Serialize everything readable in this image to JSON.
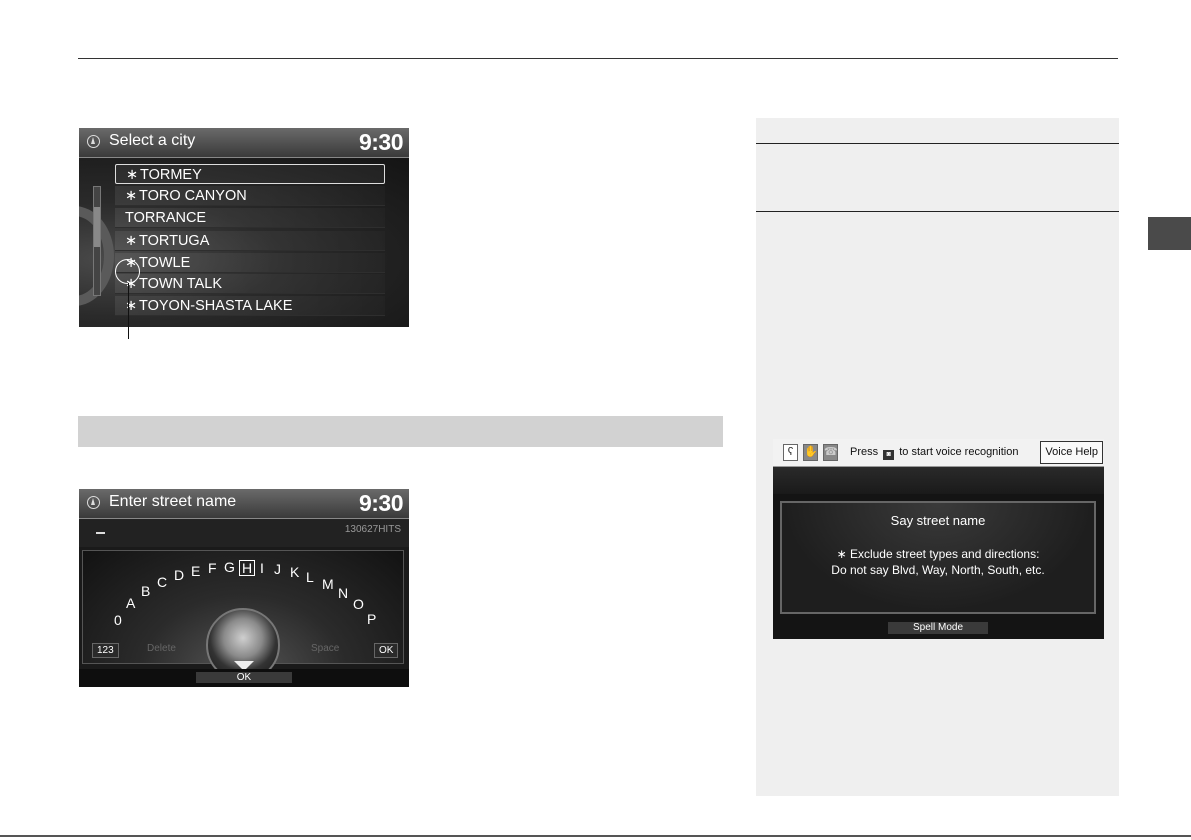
{
  "city_screen": {
    "title": "Select a city",
    "clock": "9:30",
    "cities": [
      {
        "star": "∗",
        "name": "TORMEY"
      },
      {
        "star": "∗",
        "name": "TORO CANYON"
      },
      {
        "star": "",
        "name": "TORRANCE"
      },
      {
        "star": "∗",
        "name": "TORTUGA"
      },
      {
        "star": "∗",
        "name": "TOWLE"
      },
      {
        "star": "∗",
        "name": "TOWN TALK"
      },
      {
        "star": "∗",
        "name": "TOYON-SHASTA LAKE"
      }
    ]
  },
  "street_screen": {
    "title": "Enter street name",
    "clock": "9:30",
    "hits": "130627HITS",
    "letters": [
      "0",
      "A",
      "B",
      "C",
      "D",
      "E",
      "F",
      "G",
      "H",
      "I",
      "J",
      "K",
      "L",
      "M",
      "N",
      "O",
      "P"
    ],
    "selected_letter": "H",
    "left_key": "123",
    "delete_label": "Delete",
    "space_label": "Space",
    "right_key": "OK",
    "ok_label": "OK"
  },
  "voice_screen": {
    "press_before": "Press",
    "talk_glyph": "◙",
    "press_after": "to start voice recognition",
    "voice_help": "Voice Help",
    "heading": "Say street name",
    "line1": "∗ Exclude street types and directions:",
    "line2": "Do not say Blvd, Way, North, South, etc.",
    "spell_mode": "Spell Mode"
  }
}
